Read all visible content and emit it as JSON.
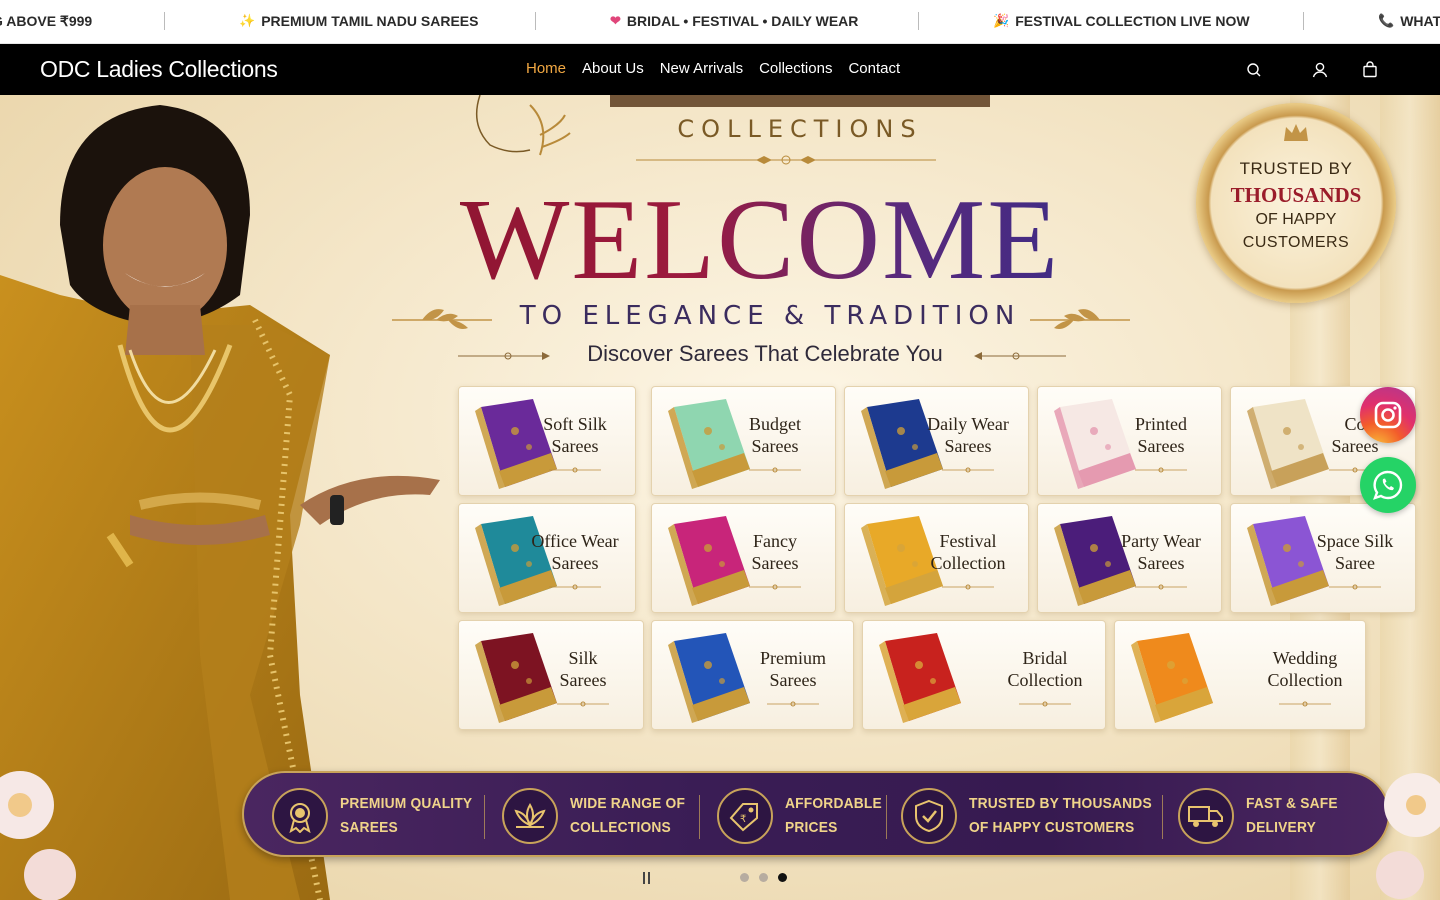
{
  "ticker": {
    "items": [
      {
        "icon": "",
        "text": "G ABOVE ₹999"
      },
      {
        "icon": "sparkle-icon",
        "text": "PREMIUM TAMIL NADU SAREES"
      },
      {
        "icon": "heart-icon",
        "text": "BRIDAL • FESTIVAL • DAILY WEAR"
      },
      {
        "icon": "party-popper-icon",
        "text": "FESTIVAL COLLECTION LIVE NOW"
      },
      {
        "icon": "phone-icon",
        "text": "WHAT"
      }
    ]
  },
  "header": {
    "brand": "ODC Ladies Collections",
    "nav": [
      {
        "label": "Home",
        "active": true
      },
      {
        "label": "About Us",
        "active": false
      },
      {
        "label": "New Arrivals",
        "active": false
      },
      {
        "label": "Collections",
        "active": false
      },
      {
        "label": "Contact",
        "active": false
      }
    ],
    "icons": [
      "search-icon",
      "account-icon",
      "cart-icon"
    ]
  },
  "hero": {
    "logo_sub": "COLLECTIONS",
    "headline": "WELCOME",
    "tagline": "TO ELEGANCE & TRADITION",
    "subtagline": "Discover Sarees That Celebrate You",
    "badge": {
      "line1": "TRUSTED BY",
      "line2": "THOUSANDS",
      "line3": "OF HAPPY",
      "line4": "CUSTOMERS"
    },
    "categories": [
      {
        "l1": "Soft Silk",
        "l2": "Sarees",
        "color": "#6a2a9a",
        "border": "#c89a3a"
      },
      {
        "l1": "Budget",
        "l2": "Sarees",
        "color": "#8fd6b0",
        "border": "#c89a3a"
      },
      {
        "l1": "Daily Wear",
        "l2": "Sarees",
        "color": "#1d3a8f",
        "border": "#c89a3a"
      },
      {
        "l1": "Printed",
        "l2": "Sarees",
        "color": "#f6e8e4",
        "border": "#e59ab0"
      },
      {
        "l1": "Co",
        "l2": "Sarees",
        "color": "#efe3c6",
        "border": "#c8a15a"
      },
      {
        "l1": "Office Wear",
        "l2": "Sarees",
        "color": "#1f8a9a",
        "border": "#c89a3a"
      },
      {
        "l1": "Fancy",
        "l2": "Sarees",
        "color": "#c8257a",
        "border": "#c89a3a"
      },
      {
        "l1": "Festival",
        "l2": "Collection",
        "color": "#e8a928",
        "border": "#d4a43c"
      },
      {
        "l1": "Party Wear",
        "l2": "Sarees",
        "color": "#4b1d7a",
        "border": "#c89a3a"
      },
      {
        "l1": "Space Silk",
        "l2": "Saree",
        "color": "#8b55d4",
        "border": "#c89a3a"
      },
      {
        "l1": "Silk",
        "l2": "Sarees",
        "color": "#7d1322",
        "border": "#c89a3a"
      },
      {
        "l1": "Premium",
        "l2": "Sarees",
        "color": "#2355b8",
        "border": "#c89a3a"
      },
      {
        "l1": "Bridal",
        "l2": "Collection",
        "color": "#c8221e",
        "border": "#d9a53a"
      },
      {
        "l1": "Wedding",
        "l2": "Collection",
        "color": "#ef8a1c",
        "border": "#d9a53a"
      }
    ],
    "features": [
      {
        "icon": "medal-icon",
        "l1": "PREMIUM QUALITY",
        "l2": "SAREES"
      },
      {
        "icon": "lotus-icon",
        "l1": "WIDE RANGE OF",
        "l2": "COLLECTIONS"
      },
      {
        "icon": "price-tag-icon",
        "l1": "AFFORDABLE",
        "l2": "PRICES"
      },
      {
        "icon": "shield-check-icon",
        "l1": "TRUSTED BY THOUSANDS",
        "l2": "OF HAPPY CUSTOMERS"
      },
      {
        "icon": "delivery-truck-icon",
        "l1": "FAST & SAFE",
        "l2": "DELIVERY"
      }
    ],
    "slider": {
      "slides": 3,
      "current": 3,
      "paused": true
    }
  },
  "social": [
    "instagram-icon",
    "whatsapp-icon"
  ],
  "colors": {
    "accent": "#f0a742",
    "header_bg": "#000000",
    "strip_bg": "#3a1d55",
    "gold": "#c8a35a"
  }
}
